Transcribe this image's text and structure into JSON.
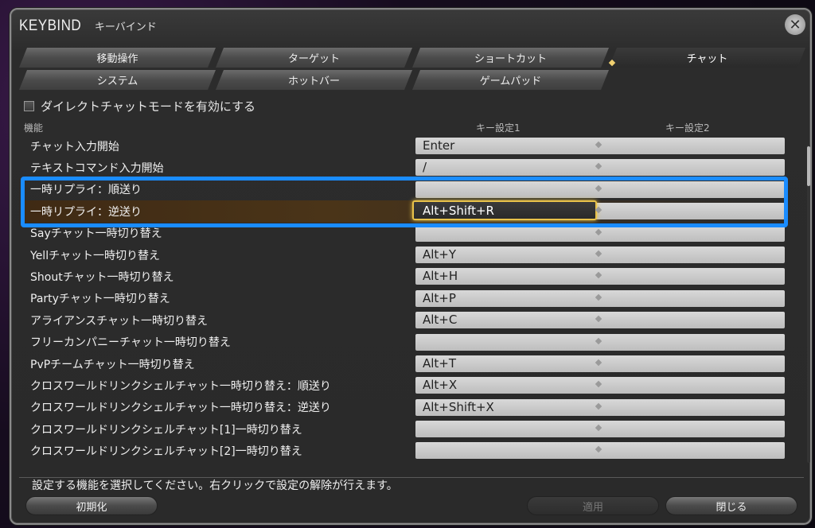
{
  "window": {
    "title_en": "KEYBIND",
    "title_jp": "キーバインド"
  },
  "tabs": {
    "row1": [
      "移動操作",
      "ターゲット",
      "ショートカット",
      "チャット"
    ],
    "row2": [
      "システム",
      "ホットバー",
      "ゲームパッド"
    ],
    "active": "チャット"
  },
  "direct_chat": {
    "label": "ダイレクトチャットモードを有効にする",
    "checked": false
  },
  "columns": {
    "function": "機能",
    "key1": "キー設定1",
    "key2": "キー設定2"
  },
  "rows": [
    {
      "label": "チャット入力開始",
      "key1": "Enter",
      "key2": ""
    },
    {
      "label": "テキストコマンド入力開始",
      "key1": "/",
      "key2": ""
    },
    {
      "label": "一時リプライ：順送り",
      "key1": "",
      "key2": ""
    },
    {
      "label": "一時リプライ：逆送り",
      "key1": "Alt+Shift+R",
      "key2": ""
    },
    {
      "label": "Sayチャット一時切り替え",
      "key1": "",
      "key2": ""
    },
    {
      "label": "Yellチャット一時切り替え",
      "key1": "Alt+Y",
      "key2": ""
    },
    {
      "label": "Shoutチャット一時切り替え",
      "key1": "Alt+H",
      "key2": ""
    },
    {
      "label": "Partyチャット一時切り替え",
      "key1": "Alt+P",
      "key2": ""
    },
    {
      "label": "アライアンスチャット一時切り替え",
      "key1": "Alt+C",
      "key2": ""
    },
    {
      "label": "フリーカンパニーチャット一時切り替え",
      "key1": "",
      "key2": ""
    },
    {
      "label": "PvPチームチャット一時切り替え",
      "key1": "Alt+T",
      "key2": ""
    },
    {
      "label": "クロスワールドリンクシェルチャット一時切り替え：順送り",
      "key1": "Alt+X",
      "key2": ""
    },
    {
      "label": "クロスワールドリンクシェルチャット一時切り替え：逆送り",
      "key1": "Alt+Shift+X",
      "key2": ""
    },
    {
      "label": "クロスワールドリンクシェルチャット[1]一時切り替え",
      "key1": "",
      "key2": ""
    },
    {
      "label": "クロスワールドリンクシェルチャット[2]一時切り替え",
      "key1": "",
      "key2": ""
    }
  ],
  "selected_row": 3,
  "hint": "設定する機能を選択してください。右クリックで設定の解除が行えます。",
  "buttons": {
    "reset": "初期化",
    "apply": "適用",
    "close": "閉じる"
  },
  "colors": {
    "highlight": "#1a8cff",
    "selection": "#e8c24a"
  }
}
